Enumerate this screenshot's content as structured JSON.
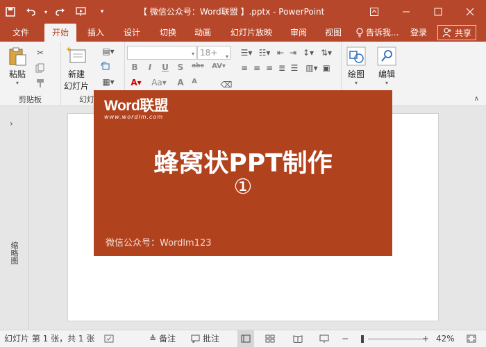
{
  "app": {
    "title": "【 微信公众号：Word联盟 】.pptx - PowerPoint"
  },
  "tabs": [
    {
      "label": "文件"
    },
    {
      "label": "开始"
    },
    {
      "label": "插入"
    },
    {
      "label": "设计"
    },
    {
      "label": "切换"
    },
    {
      "label": "动画"
    },
    {
      "label": "幻灯片放映"
    },
    {
      "label": "审阅"
    },
    {
      "label": "视图"
    }
  ],
  "tell_me": "告诉我...",
  "login": "登录",
  "share": "共享",
  "ribbon": {
    "paste_label": "粘贴",
    "clipboard_group": "剪贴板",
    "new_slide_line1": "新建",
    "new_slide_line2": "幻灯片",
    "slides_group": "幻灯",
    "font_size": "18+",
    "drawing_label": "绘图",
    "editing_label": "编辑"
  },
  "thumbnail_label": "缩略图",
  "slide": {
    "logo_text": "Word联盟",
    "logo_url": "www.wordlm.com",
    "title": "蜂窝状PPT制作",
    "number": "①",
    "footer": "微信公众号：Wordlm123"
  },
  "status": {
    "slide_info": "幻灯片 第 1 张，共 1 张",
    "notes": "备注",
    "comments": "批注",
    "zoom": "42%"
  },
  "colors": {
    "brand": "#b7472a",
    "slide_bg": "#b1421e"
  }
}
